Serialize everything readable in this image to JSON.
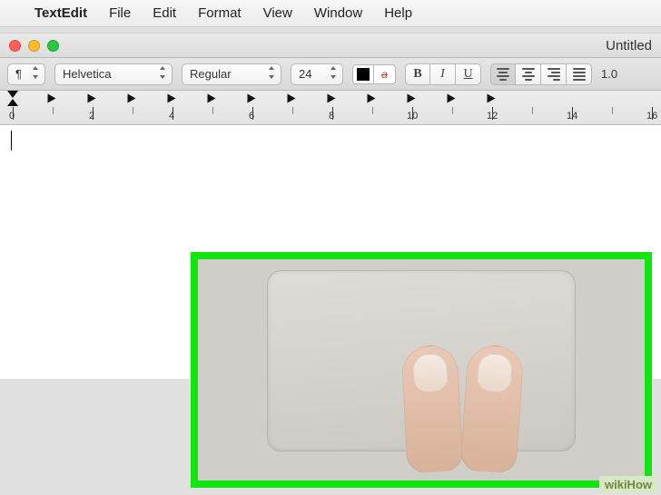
{
  "menubar": {
    "apple": "",
    "app": "TextEdit",
    "items": [
      "File",
      "Edit",
      "Format",
      "View",
      "Window",
      "Help"
    ]
  },
  "window": {
    "title": "Untitled"
  },
  "toolbar": {
    "pilcrow": "¶",
    "font": "Helvetica",
    "style": "Regular",
    "size": "24",
    "bold": "B",
    "italic": "I",
    "underline": "U",
    "spacing": "1.0"
  },
  "ruler": {
    "labels": [
      "0",
      "2",
      "4",
      "6",
      "8",
      "10",
      "12",
      "14",
      "16"
    ]
  },
  "overlay": {
    "subject": "trackpad-two-finger-gesture"
  },
  "watermark": "wikiHow"
}
